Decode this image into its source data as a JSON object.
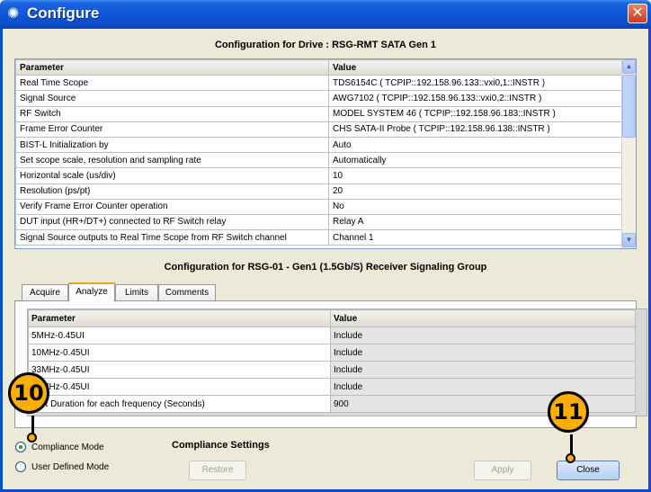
{
  "window": {
    "title": "Configure",
    "close_symbol": "✕"
  },
  "drive_title": "Configuration for Drive : RSG-RMT SATA Gen 1",
  "top_table": {
    "headers": [
      "Parameter",
      "Value"
    ],
    "rows": [
      [
        "Real Time Scope",
        "TDS6154C ( TCPIP::192.158.96.133::vxi0,1::INSTR )"
      ],
      [
        "Signal Source",
        "AWG7102 ( TCPIP::192.158.96.133::vxi0,2::INSTR )"
      ],
      [
        "RF Switch",
        "MODEL SYSTEM 46 ( TCPIP::192.158.96.183::INSTR )"
      ],
      [
        "Frame Error Counter",
        "CHS SATA-II Probe ( TCPIP::192.158.96.138::INSTR )"
      ],
      [
        "BIST-L Initialization by",
        "Auto"
      ],
      [
        "Set scope scale, resolution and sampling rate",
        "Automatically"
      ],
      [
        "Horizontal scale (us/div)",
        "10"
      ],
      [
        "Resolution (ps/pt)",
        "20"
      ],
      [
        "Verify Frame Error Counter operation",
        "No"
      ],
      [
        "DUT input (HR+/DT+) connected to RF Switch relay",
        "Relay A"
      ],
      [
        "Signal Source outputs to Real Time Scope from RF Switch channel",
        "Channel 1"
      ]
    ]
  },
  "group_title": "Configuration for RSG-01 - Gen1 (1.5Gb/S) Receiver Signaling Group",
  "tabs": [
    "Acquire",
    "Analyze",
    "Limits",
    "Comments"
  ],
  "active_tab": "Analyze",
  "inner_table": {
    "headers": [
      "Parameter",
      "Value"
    ],
    "rows": [
      [
        "5MHz-0.45UI",
        "Include"
      ],
      [
        "10MHz-0.45UI",
        "Include"
      ],
      [
        "33MHz-0.45UI",
        "Include"
      ],
      [
        "62MHz-0.45UI",
        "Include"
      ],
      [
        "Test Duration for each frequency (Seconds)",
        "900"
      ]
    ]
  },
  "modes": {
    "compliance": "Compliance Mode",
    "user_defined": "User Defined Mode",
    "selected": "Compliance Mode"
  },
  "compliance_settings_label": "Compliance Settings",
  "buttons": {
    "restore": "Restore",
    "apply": "Apply",
    "close": "Close"
  },
  "callouts": {
    "mode_step": "10",
    "close_step": "11"
  },
  "colors": {
    "titlebar": "#0b4cc8",
    "callout": "#ffae00",
    "active_tab_accent": "#e8a334"
  }
}
